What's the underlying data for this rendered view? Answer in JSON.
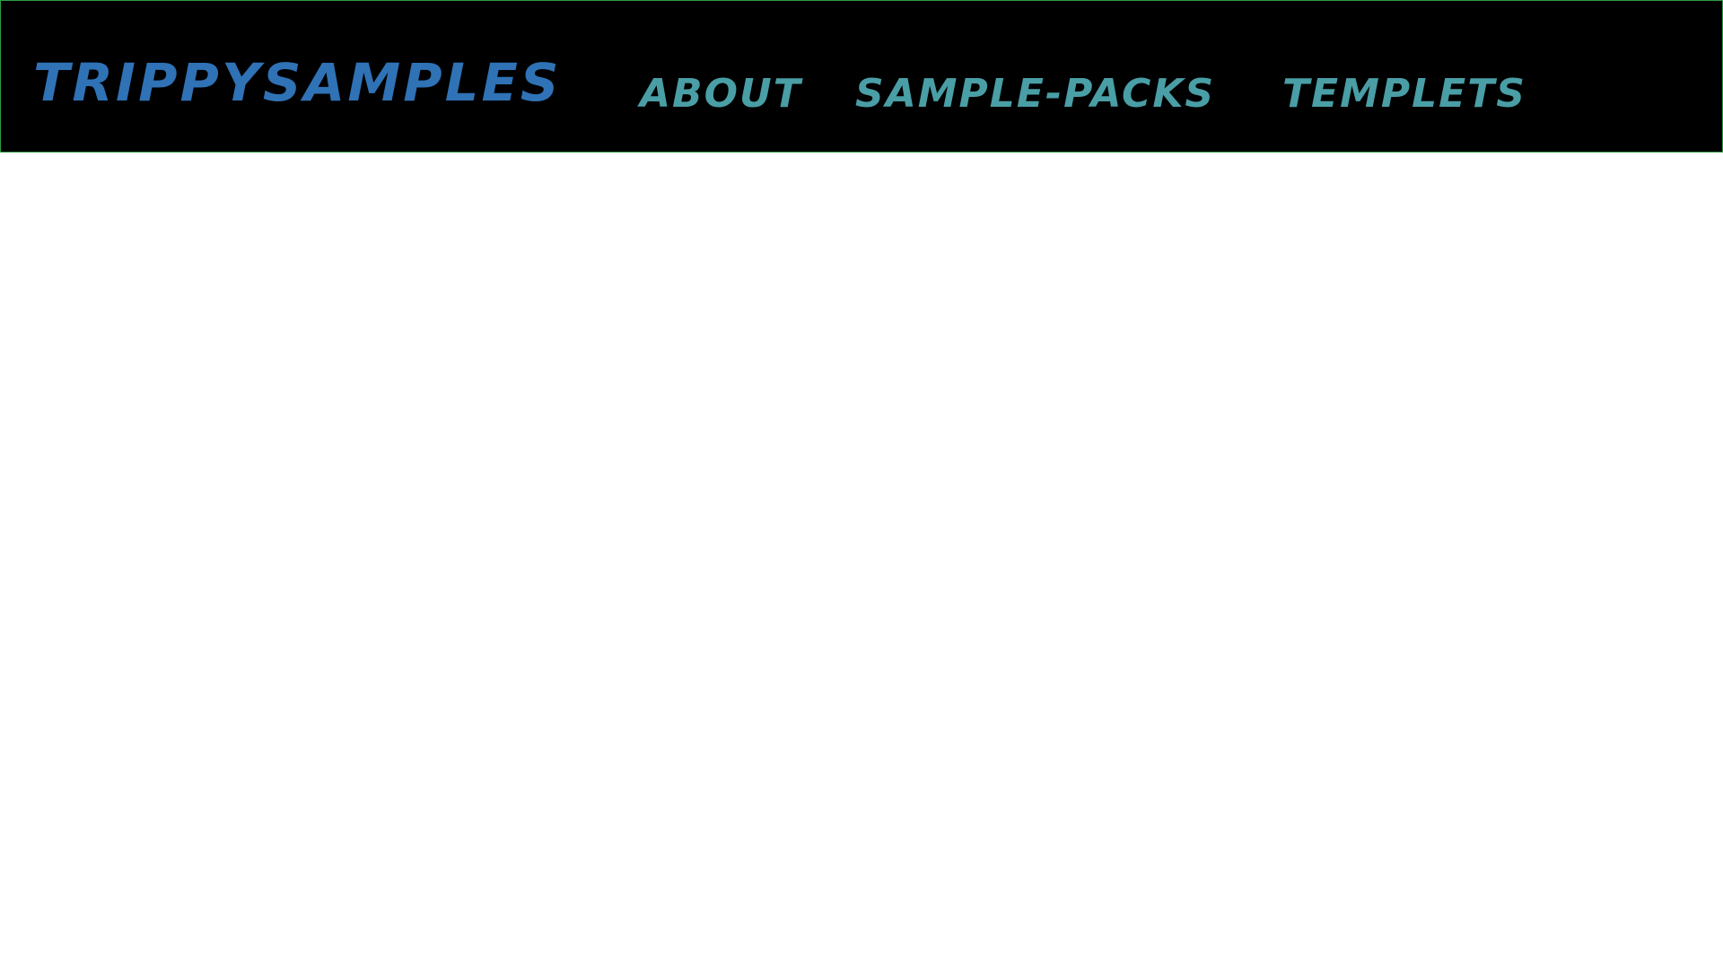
{
  "header": {
    "brand": "TRIPPYSAMPLES",
    "nav": [
      {
        "label": "ABOUT"
      },
      {
        "label": "SAMPLE-PACKS"
      },
      {
        "label": "TEMPLETS"
      }
    ]
  },
  "colors": {
    "header_background": "#000000",
    "header_border": "#2f9e44",
    "brand": "#2f72b6",
    "nav": "#4a9ea6",
    "page_background": "#ffffff"
  }
}
